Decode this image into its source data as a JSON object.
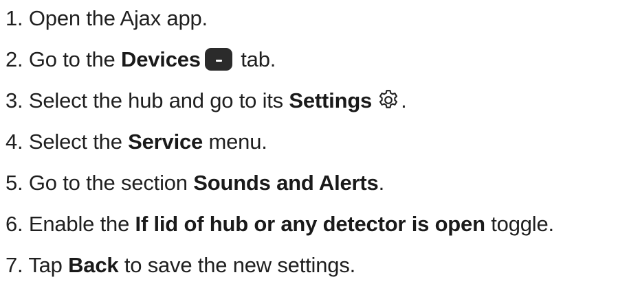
{
  "steps": [
    {
      "num": "1. ",
      "before": "Open the Ajax app.",
      "bold": "",
      "after": ""
    },
    {
      "num": "2. ",
      "before": "Go to the ",
      "bold": "Devices",
      "after": " tab.",
      "icon": "devices-icon"
    },
    {
      "num": "3. ",
      "before": "Select the hub and go to its ",
      "bold": "Settings",
      "after": ".",
      "icon": "gear-icon"
    },
    {
      "num": "4. ",
      "before": "Select the ",
      "bold": "Service",
      "after": " menu."
    },
    {
      "num": "5. ",
      "before": "Go to the section ",
      "bold": "Sounds and Alerts",
      "after": "."
    },
    {
      "num": "6. ",
      "before": "Enable the ",
      "bold": "If lid of hub or any detector is open",
      "after": " toggle."
    },
    {
      "num": "7. ",
      "before": "Tap ",
      "bold": "Back",
      "after": " to save the new settings."
    }
  ]
}
